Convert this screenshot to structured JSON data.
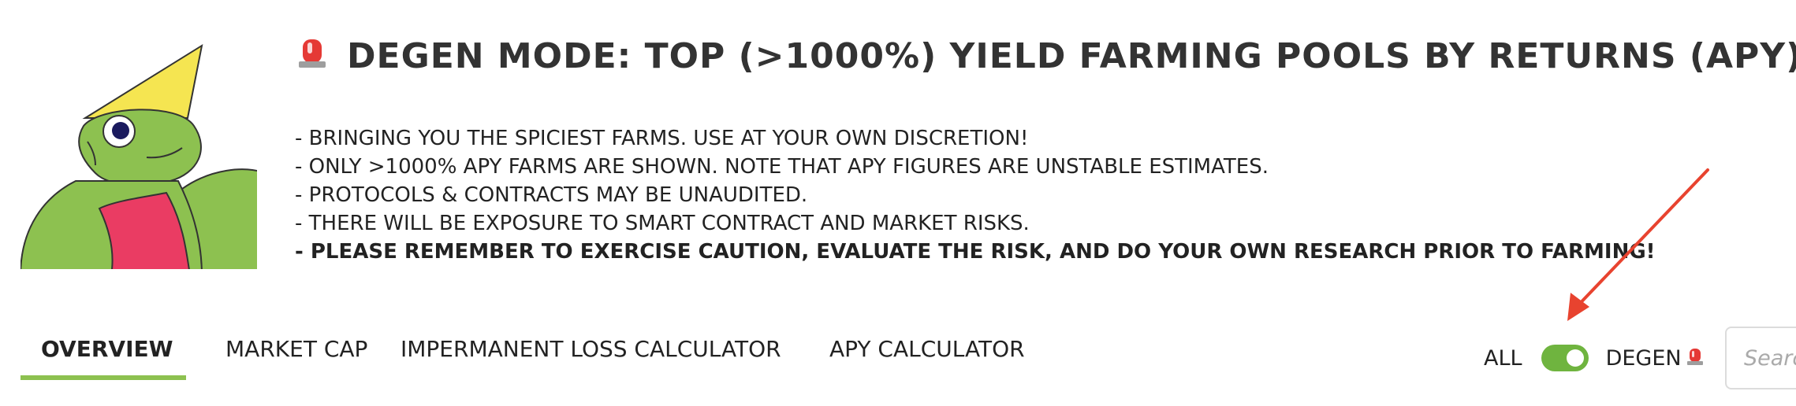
{
  "header": {
    "title": "DEGEN MODE: TOP (>1000%) YIELD FARMING POOLS BY RETURNS (APY)",
    "notes": [
      "- BRINGING YOU THE SPICIEST FARMS. USE AT YOUR OWN DISCRETION!",
      "- ONLY >1000% APY FARMS ARE SHOWN. NOTE THAT APY FIGURES ARE UNSTABLE ESTIMATES.",
      "- PROTOCOLS & CONTRACTS MAY BE UNAUDITED.",
      "- THERE WILL BE EXPOSURE TO SMART CONTRACT AND MARKET RISKS.",
      "- PLEASE REMEMBER TO EXERCISE CAUTION, EVALUATE THE RISK, AND DO YOUR OWN RESEARCH PRIOR TO FARMING!"
    ]
  },
  "tabs": [
    {
      "label": "OVERVIEW",
      "active": true
    },
    {
      "label": "MARKET CAP",
      "active": false
    },
    {
      "label": "IMPERMANENT LOSS CALCULATOR",
      "active": false
    },
    {
      "label": "APY CALCULATOR",
      "active": false
    }
  ],
  "toggle": {
    "left_label": "ALL",
    "right_label": "DEGEN",
    "state": "on"
  },
  "search": {
    "placeholder": "Search"
  },
  "icons": {
    "title_icon": "siren-icon",
    "toggle_icon": "siren-icon",
    "mascot": "frog-mascot"
  },
  "colors": {
    "accent": "#8dc150",
    "toggle": "#6fb43f",
    "siren": "#e53935",
    "arrow": "#e8432f"
  }
}
